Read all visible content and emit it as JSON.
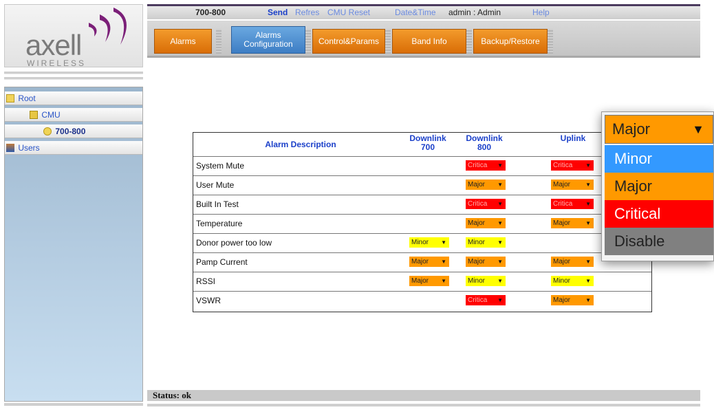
{
  "brand": {
    "name": "axell",
    "sub": "WIRELESS",
    "colors": {
      "mark": "#7b1f78"
    }
  },
  "topbar": {
    "site": "700-800",
    "send": "Send",
    "refresh": "Refres",
    "cmu_reset": "CMU Reset",
    "datetime": "Date&Time",
    "user": "admin : Admin",
    "help": "Help"
  },
  "tabs": [
    {
      "label": "Alarms",
      "active": false
    },
    {
      "label": "Alarms\nConfiguration",
      "active": true
    },
    {
      "label": "Control&Params",
      "active": false
    },
    {
      "label": "Band Info",
      "active": false
    },
    {
      "label": "Backup/Restore",
      "active": false
    }
  ],
  "tree": {
    "root": "Root",
    "cmu": "CMU",
    "node": "700-800",
    "users": "Users"
  },
  "table": {
    "headers": {
      "desc": "Alarm Description",
      "dl700_a": "Downlink",
      "dl700_b": "700",
      "dl800_a": "Downlink",
      "dl800_b": "800",
      "uplink": "Uplink"
    },
    "rows": [
      {
        "label": "System Mute",
        "dl700": "",
        "dl800": "Critical",
        "ul": "Critical"
      },
      {
        "label": "User Mute",
        "dl700": "",
        "dl800": "Major",
        "ul": "Major"
      },
      {
        "label": "Built In Test",
        "dl700": "",
        "dl800": "Critical",
        "ul": "Critical"
      },
      {
        "label": "Temperature",
        "dl700": "",
        "dl800": "Major",
        "ul": "Major"
      },
      {
        "label": "Donor power too low",
        "dl700": "Minor",
        "dl800": "Minor",
        "ul": ""
      },
      {
        "label": "Pamp Current",
        "dl700": "Major",
        "dl800": "Major",
        "ul": "Major"
      },
      {
        "label": "RSSI",
        "dl700": "Major",
        "dl800": "Minor",
        "ul": "Minor"
      },
      {
        "label": "VSWR",
        "dl700": "",
        "dl800": "Critical",
        "ul": "Major"
      }
    ],
    "critical_short": "Critica"
  },
  "zoom_dropdown": {
    "selected": "Major",
    "options": [
      {
        "label": "Minor",
        "bg": "#3399ff",
        "fg": "#ffffff"
      },
      {
        "label": "Major",
        "bg": "#ff9900",
        "fg": "#222222"
      },
      {
        "label": "Critical",
        "bg": "#ff0000",
        "fg": "#ffffff"
      },
      {
        "label": "Disable",
        "bg": "#808080",
        "fg": "#222222"
      }
    ]
  },
  "status": {
    "text": "Status: ok"
  }
}
